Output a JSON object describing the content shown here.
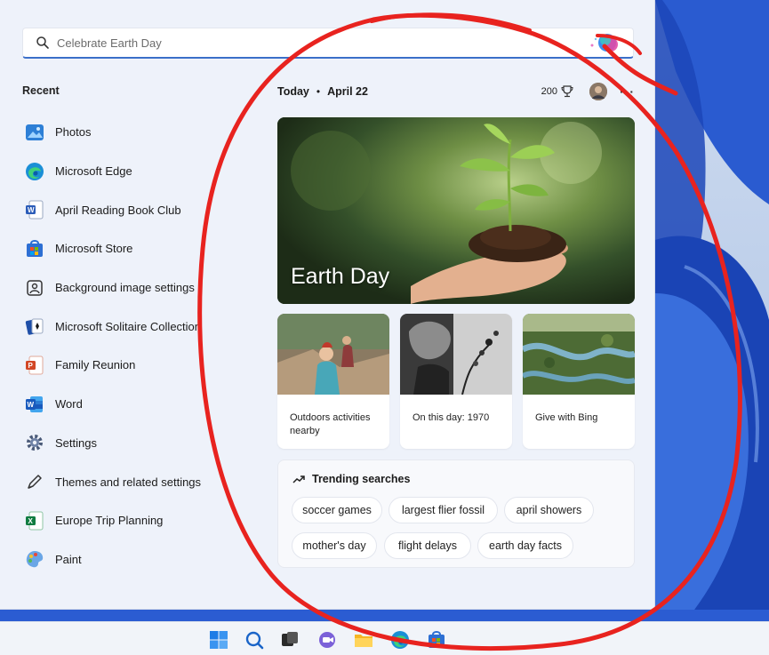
{
  "search": {
    "placeholder": "Celebrate Earth Day"
  },
  "recent": {
    "title": "Recent",
    "items": [
      {
        "label": "Photos",
        "icon": "photos-icon"
      },
      {
        "label": "Microsoft Edge",
        "icon": "edge-icon"
      },
      {
        "label": "April Reading Book Club",
        "icon": "word-doc-icon"
      },
      {
        "label": "Microsoft Store",
        "icon": "store-icon"
      },
      {
        "label": "Background image settings",
        "icon": "image-settings-icon"
      },
      {
        "label": "Microsoft Solitaire Collection",
        "icon": "solitaire-icon"
      },
      {
        "label": "Family Reunion",
        "icon": "powerpoint-icon"
      },
      {
        "label": "Word",
        "icon": "word-icon"
      },
      {
        "label": "Settings",
        "icon": "gear-icon"
      },
      {
        "label": "Themes and related settings",
        "icon": "pen-icon"
      },
      {
        "label": "Europe Trip Planning",
        "icon": "excel-icon"
      },
      {
        "label": "Paint",
        "icon": "paint-icon"
      }
    ]
  },
  "header": {
    "today": "Today",
    "separator": "•",
    "date": "April 22",
    "points": "200",
    "more": "···"
  },
  "hero": {
    "title": "Earth Day"
  },
  "cards": [
    {
      "caption": "Outdoors activities nearby"
    },
    {
      "caption": "On this day: 1970"
    },
    {
      "caption": "Give with Bing"
    }
  ],
  "trending": {
    "title": "Trending searches",
    "pills": [
      "soccer games",
      "largest flier fossil",
      "april showers",
      "mother's day",
      "flight delays",
      "earth day facts"
    ]
  },
  "taskbar": {
    "icons": [
      "start-icon",
      "search-icon",
      "task-view-icon",
      "teams-icon",
      "file-explorer-icon",
      "edge-icon",
      "store-icon"
    ]
  },
  "colors": {
    "accent": "#3b6fc9",
    "annotation": "#e8231f"
  }
}
